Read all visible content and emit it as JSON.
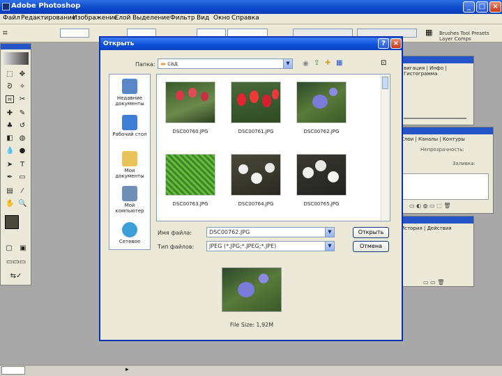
{
  "app": {
    "title": "Adobe Photoshop",
    "menus": [
      "Файл",
      "Редактирование",
      "Изображение",
      "Слой",
      "Выделение",
      "Фильтр",
      "Вид",
      "Окно",
      "Справка"
    ]
  },
  "panels": {
    "nav_tabs": "вигация | Инфо | Гистограмма",
    "layers_tabs": "Слои | Каналы | Контуры",
    "opacity_label": "Непрозрачность:",
    "fill_label": "Заливка:",
    "history_tab": "История | Действия",
    "palette_tabs": [
      "Brushes",
      "Tool Presets",
      "Layer Comps"
    ]
  },
  "dialog": {
    "title": "Открыть",
    "lookin_label": "Папка:",
    "folder": "сад",
    "places": [
      {
        "label": "Недавние документы",
        "icon": "recent-documents-icon"
      },
      {
        "label": "Рабочий стол",
        "icon": "desktop-icon"
      },
      {
        "label": "Мои документы",
        "icon": "my-documents-icon"
      },
      {
        "label": "Мой компьютер",
        "icon": "my-computer-icon"
      },
      {
        "label": "Сетевое",
        "icon": "network-icon"
      }
    ],
    "files": [
      {
        "name": "DSC00760.JPG",
        "thumb": "red-tulips-dark"
      },
      {
        "name": "DSC00761.JPG",
        "thumb": "red-tulips"
      },
      {
        "name": "DSC00762.JPG",
        "thumb": "blue-periwinkle"
      },
      {
        "name": "DSC00763.JPG",
        "thumb": "green-fir"
      },
      {
        "name": "DSC00764.JPG",
        "thumb": "white-blossom"
      },
      {
        "name": "DSC00765.JPG",
        "thumb": "white-blossom-2"
      }
    ],
    "filename_label": "Имя файла:",
    "filename_value": "DSC00762.JPG",
    "filetype_label": "Тип файлов:",
    "filetype_value": "JPEG (*.JPG;*.JPEG;*.JPE)",
    "open_button": "Открыть",
    "cancel_button": "Отмена",
    "file_size": "File Size: 1,92M"
  },
  "colors": {
    "title_blue": "#0a46c8",
    "dialog_bg": "#ece9d8",
    "workspace": "#a8a8a8"
  }
}
